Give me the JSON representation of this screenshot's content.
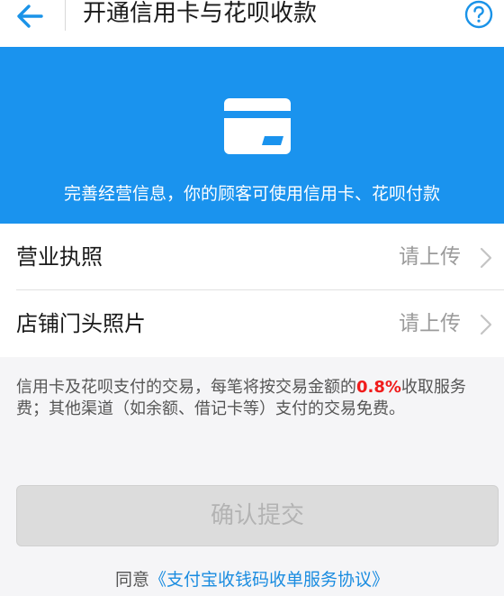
{
  "header": {
    "title": "开通信用卡与花呗收款",
    "back_icon": "arrow-left-icon",
    "help_icon": "question-circle-icon"
  },
  "banner": {
    "icon": "credit-card-icon",
    "text": "完善经营信息，你的顾客可使用信用卡、花呗付款"
  },
  "form": {
    "rows": [
      {
        "label": "营业执照",
        "value": "请上传"
      },
      {
        "label": "店铺门头照片",
        "value": "请上传"
      }
    ]
  },
  "notice": {
    "prefix": "信用卡及花呗支付的交易，每笔将按交易金额的",
    "rate": "0.8%",
    "suffix": "收取服务费；其他渠道（如余额、借记卡等）支付的交易免费。"
  },
  "submit": {
    "label": "确认提交"
  },
  "agreement": {
    "prefix": "同意",
    "link": "《支付宝收钱码收单服务协议》"
  },
  "colors": {
    "accent": "#1a93ee",
    "rate": "#f01c1c",
    "link": "#1a8ce0"
  }
}
